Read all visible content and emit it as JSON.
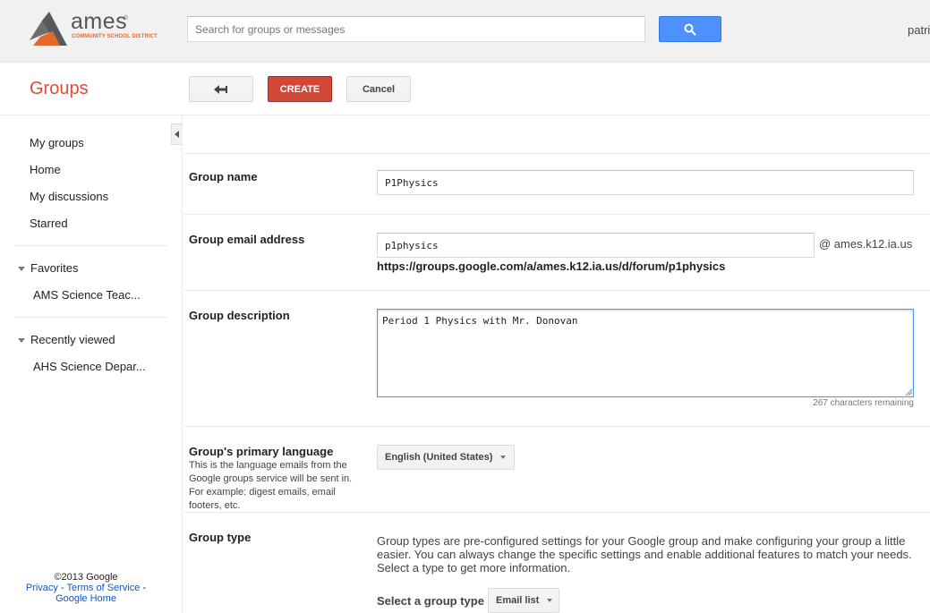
{
  "header": {
    "logo_text": "ames",
    "logo_tm": "®",
    "logo_subline": "COMMUNITY SCHOOL DISTRICT",
    "search_placeholder": "Search for groups or messages",
    "user_name": "patri"
  },
  "app_title": "Groups",
  "toolbar": {
    "create_label": "CREATE",
    "cancel_label": "Cancel"
  },
  "sidebar": {
    "items": [
      {
        "label": "My groups"
      },
      {
        "label": "Home"
      },
      {
        "label": "My discussions"
      },
      {
        "label": "Starred"
      }
    ],
    "favorites": {
      "label": "Favorites",
      "items": [
        {
          "label": "AMS Science Teac..."
        }
      ]
    },
    "recently_viewed": {
      "label": "Recently viewed",
      "items": [
        {
          "label": "AHS Science Depar..."
        }
      ]
    }
  },
  "footer": {
    "copyright": "©2013 Google",
    "privacy": "Privacy",
    "sep1": " - ",
    "terms": "Terms of Service",
    "sep2": " -",
    "home": "Google Home"
  },
  "form": {
    "group_name": {
      "label": "Group name",
      "value": "P1Physics"
    },
    "group_email": {
      "label": "Group email address",
      "value": "p1physics",
      "domain": "@ ames.k12.ia.us",
      "url": "https://groups.google.com/a/ames.k12.ia.us/d/forum/p1physics"
    },
    "group_description": {
      "label": "Group description",
      "value": "Period 1 Physics with Mr. Donovan",
      "remaining": "267 characters remaining"
    },
    "primary_language": {
      "label": "Group's primary language",
      "hint": "This is the language emails from the Google groups service will be sent in. For example: digest emails, email footers, etc.",
      "value": "English (United States)"
    },
    "group_type": {
      "label": "Group type",
      "description": "Group types are pre-configured settings for your Google group and make configuring your group a little easier. You can always change the specific settings and enable additional features to match your needs. Select a type to get more information.",
      "select_label": "Select a group type",
      "value": "Email list"
    }
  },
  "colors": {
    "accent_red": "#dd4b39",
    "create_red": "#d14836",
    "search_blue": "#4d90fe",
    "logo_orange": "#e26a2c"
  }
}
